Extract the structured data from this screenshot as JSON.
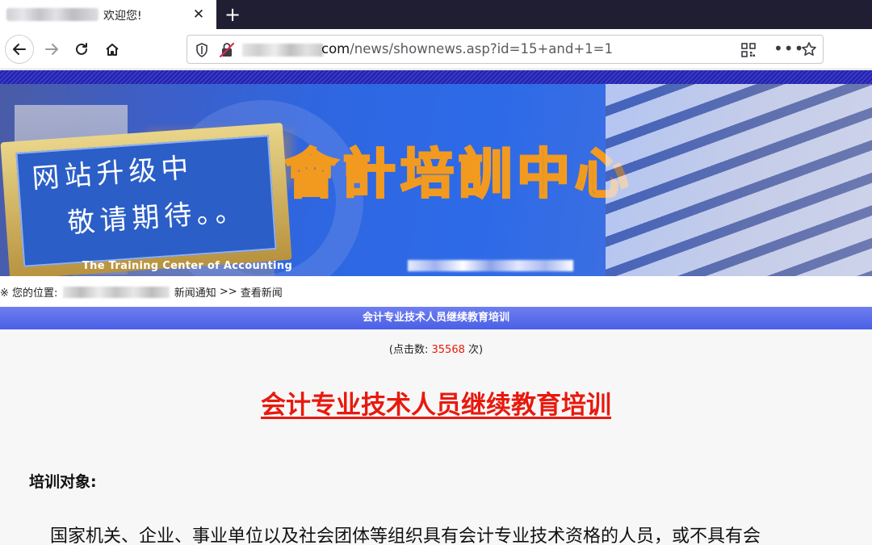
{
  "browser": {
    "tab": {
      "title": "欢迎您!",
      "close": "✕"
    },
    "new_tab": "+",
    "url": {
      "host_suffix": "com",
      "path": "/news/shownews.asp?id=15+and+1=1"
    },
    "more": "•••"
  },
  "banner": {
    "title": "會計培訓中心",
    "scroll_line1": "网站升级中",
    "scroll_line2": "敬请期待。。",
    "subtitle_en": "The Training Center of Accounting"
  },
  "breadcrumb": {
    "prefix": "※ 您的位置:",
    "section": "新闻通知",
    "separator": ">>",
    "current": "查看新闻"
  },
  "article": {
    "bar_title": "会计专业技术人员继续教育培训",
    "hits_open": "(点击数:",
    "hits_count": "35568",
    "hits_close": "次)",
    "title": "会计专业技术人员继续教育培训",
    "section_head": "培训对象:",
    "paragraph": "国家机关、企业、事业单位以及社会团体等组织具有会计专业技术资格的人员，或不具有会"
  },
  "colors": {
    "tab_bar": "#1f1e33",
    "header_blue": "#2f66e0",
    "title_bar": "#4a5fe6",
    "accent_red": "#e8190e",
    "banner_orange": "#f29a1f"
  }
}
